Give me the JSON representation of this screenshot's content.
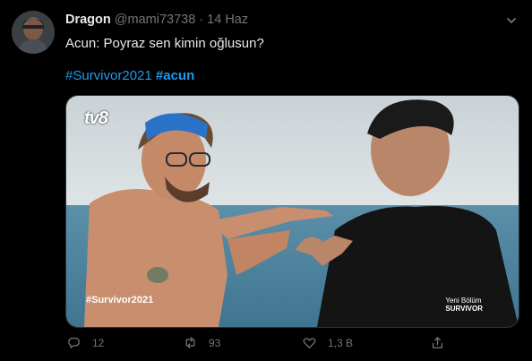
{
  "tweet": {
    "author_name": "Dragon",
    "handle": "@mami73738",
    "separator": "·",
    "date": "14 Haz",
    "text": "Acun: Poyraz sen kimin oğlusun?",
    "hashtags": [
      "#Survivor2021",
      "#acun"
    ]
  },
  "media": {
    "channel_logo": "tv8",
    "hashtag_bug": "#Survivor2021",
    "new_episode_line1": "Yeni Bölüm",
    "new_episode_line2": "SURVIVOR"
  },
  "actions": {
    "reply": {
      "icon": "reply-icon",
      "count": "12"
    },
    "retweet": {
      "icon": "retweet-icon",
      "count": "93"
    },
    "like": {
      "icon": "heart-icon",
      "count": "1,3 B"
    },
    "share": {
      "icon": "share-icon",
      "count": ""
    }
  },
  "colors": {
    "background": "#000000",
    "accent": "#1d9bf0",
    "muted": "#6e767d"
  }
}
